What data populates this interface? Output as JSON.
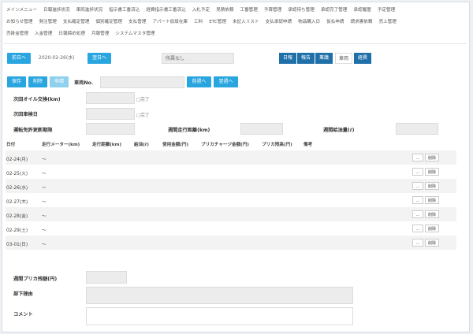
{
  "menu": {
    "row1": [
      "メインメニュー",
      "日報進捗状況",
      "車両進捗状況",
      "指示書工番済込",
      "経費指示書工番済込",
      "入札予定",
      "見積依頼",
      "工番管理",
      "予算管理",
      "承認待ち管理",
      "承認完了管理",
      "承認履歴",
      "予定管理"
    ],
    "row2": [
      "お知らせ管理",
      "発注管理",
      "支払確定管理",
      "個別確定管理",
      "支払管理",
      "アパート仮設在庫",
      "工料",
      "ETC管理",
      "未記入リスト",
      "支払承認申請",
      "物品購入日",
      "仮払申請",
      "請求書依頼",
      "売上管理"
    ],
    "row3": [
      "売掛金管理",
      "入金管理",
      "日報締め処理",
      "月報管理",
      "システムマスタ管理"
    ]
  },
  "datebar": {
    "prev_label": "前日へ",
    "date_value": "2020-02-26(水)",
    "next_label": "翌日へ",
    "user_value": "所属なし",
    "tabs": [
      "日報",
      "報告",
      "稟議",
      "車両",
      "経費"
    ],
    "selected_tab": "車両"
  },
  "actions": {
    "save_label": "保存",
    "delete_label": "削除",
    "apply_label": "申請",
    "vehicle_label": "車両No.",
    "prev_week_label": "前週へ",
    "next_week_label": "翌週へ"
  },
  "info": {
    "oil_label": "次回オイル交換(km)",
    "oil_done": "□完了",
    "inspection_label": "次回車検日",
    "inspection_done": "□完了",
    "license_label": "運転免許更新期限",
    "weekly_distance_label": "週間走行距離(km)",
    "weekly_fuel_label": "週間給油量(ℓ)"
  },
  "table": {
    "headers": [
      "日付",
      "走行メーター(km)",
      "走行距離(km)",
      "給油(ℓ)",
      "使用金額(円)",
      "プリカチャージ金額(円)",
      "プリカ残高(円)",
      "備考"
    ],
    "rows": [
      {
        "date": "02-24(月)",
        "tilde": "〜"
      },
      {
        "date": "02-25(火)",
        "tilde": "〜"
      },
      {
        "date": "02-26(水)",
        "tilde": "〜"
      },
      {
        "date": "02-27(木)",
        "tilde": "〜"
      },
      {
        "date": "02-28(金)",
        "tilde": "〜"
      },
      {
        "date": "02-29(土)",
        "tilde": "〜"
      },
      {
        "date": "03-01(日)",
        "tilde": "〜"
      }
    ],
    "row_btn1": "...",
    "row_btn2": "削除"
  },
  "footer": {
    "balance_label": "週間プリカ残額(円)",
    "return_label": "部下理由",
    "comment_label": "コメント"
  },
  "colors": {
    "accent": "#29a6e0",
    "tab": "#1f6fa8"
  }
}
